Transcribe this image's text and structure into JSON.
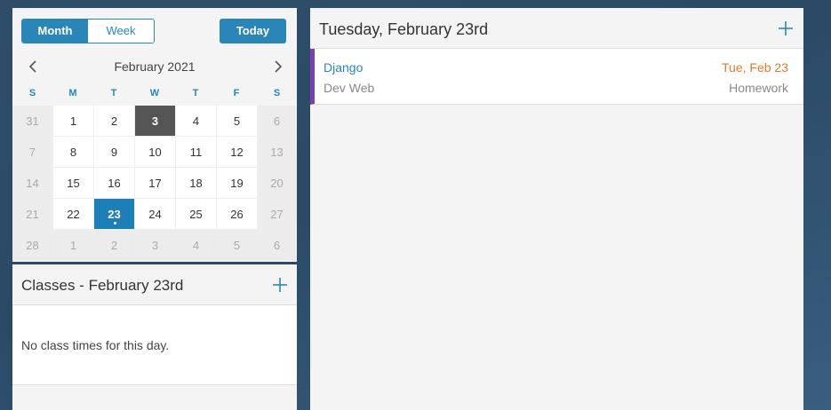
{
  "calendar": {
    "view_toggle": {
      "month": "Month",
      "week": "Week"
    },
    "today_label": "Today",
    "month_title": "February 2021",
    "weekdays": [
      "S",
      "M",
      "T",
      "W",
      "T",
      "F",
      "S"
    ],
    "weeks": [
      [
        "31",
        "1",
        "2",
        "3",
        "4",
        "5",
        "6"
      ],
      [
        "7",
        "8",
        "9",
        "10",
        "11",
        "12",
        "13"
      ],
      [
        "14",
        "15",
        "16",
        "17",
        "18",
        "19",
        "20"
      ],
      [
        "21",
        "22",
        "23",
        "24",
        "25",
        "26",
        "27"
      ],
      [
        "28",
        "1",
        "2",
        "3",
        "4",
        "5",
        "6"
      ]
    ],
    "today_day": "3",
    "selected_day": "23"
  },
  "classes": {
    "title": "Classes - February 23rd",
    "empty_message": "No class times for this day."
  },
  "day_panel": {
    "title": "Tuesday, February 23rd",
    "tasks": [
      {
        "name": "Django",
        "due": "Tue, Feb 23",
        "course": "Dev Web",
        "type": "Homework",
        "color": "#7b3fb0"
      }
    ]
  },
  "colors": {
    "accent": "#2a86b8",
    "due": "#e07b2c",
    "today_cell": "#555555"
  }
}
